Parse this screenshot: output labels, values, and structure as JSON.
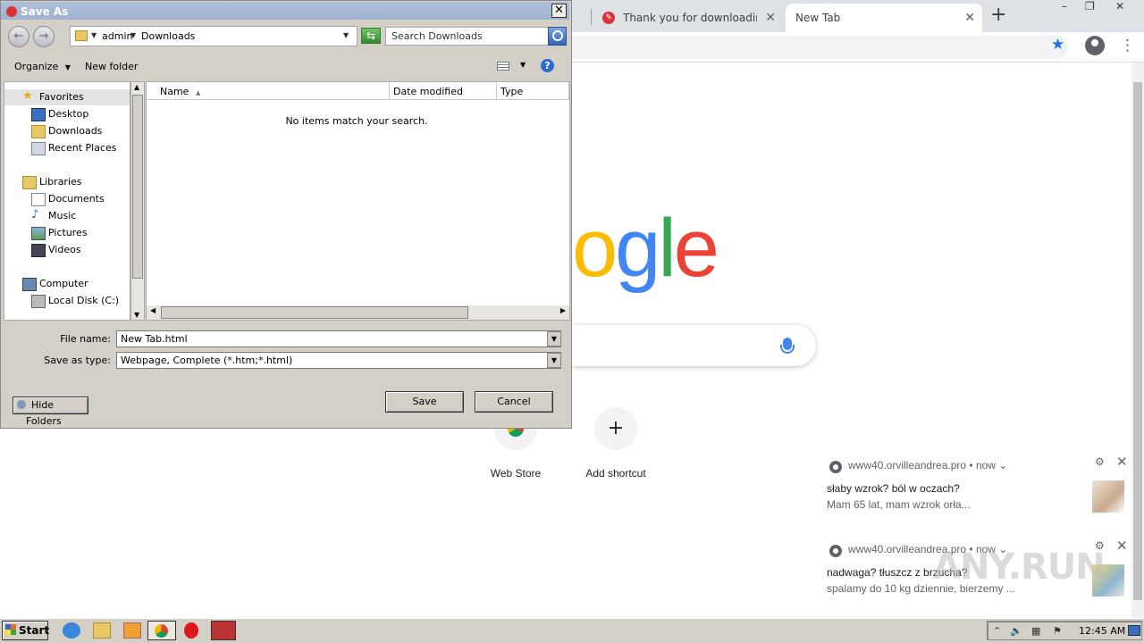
{
  "browser": {
    "tabs": [
      {
        "title": "Thank you for downloading HTT",
        "active": false
      },
      {
        "title": "New Tab",
        "active": true
      }
    ],
    "new_tab_symbol": "+",
    "window_controls": [
      "–",
      "❐",
      "✕"
    ],
    "logo_visible": "ogle",
    "shortcuts": [
      {
        "label": "Web Store"
      },
      {
        "label": "Add shortcut",
        "symbol": "+"
      }
    ],
    "notifications": [
      {
        "source": "www40.orvilleandrea.pro",
        "time": "• now ⌄",
        "title": "słaby wzrok? ból w oczach?",
        "body": "Mam 65 lat, mam wzrok orła..."
      },
      {
        "source": "www40.orvilleandrea.pro",
        "time": "• now ⌄",
        "title": "nadwaga? tłuszcz z brzucha?",
        "body": "spalamy do 10 kg dziennie, bierzemy ..."
      }
    ],
    "watermark": "ANY.RUN"
  },
  "dialog": {
    "title": "Save As",
    "address": {
      "segments": [
        "admin",
        "Downloads"
      ]
    },
    "search_placeholder": "Search Downloads",
    "toolbar": {
      "organize": "Organize",
      "new_folder": "New folder"
    },
    "nav": [
      {
        "label": "Favorites",
        "icon": "star-icon",
        "indent": 0
      },
      {
        "label": "Desktop",
        "icon": "desktop-icon",
        "indent": 1
      },
      {
        "label": "Downloads",
        "icon": "downloads-folder-icon",
        "indent": 1
      },
      {
        "label": "Recent Places",
        "icon": "recent-places-icon",
        "indent": 1
      },
      {
        "label": "Libraries",
        "icon": "libraries-icon",
        "indent": 0
      },
      {
        "label": "Documents",
        "icon": "documents-icon",
        "indent": 1
      },
      {
        "label": "Music",
        "icon": "music-icon",
        "indent": 1
      },
      {
        "label": "Pictures",
        "icon": "pictures-icon",
        "indent": 1
      },
      {
        "label": "Videos",
        "icon": "videos-icon",
        "indent": 1
      },
      {
        "label": "Computer",
        "icon": "computer-icon",
        "indent": 0
      },
      {
        "label": "Local Disk (C:)",
        "icon": "disk-icon",
        "indent": 1
      }
    ],
    "columns": [
      "Name",
      "Date modified",
      "Type"
    ],
    "empty_message": "No items match your search.",
    "file_name_label": "File name:",
    "file_name": "New Tab.html",
    "save_type_label": "Save as type:",
    "save_type": "Webpage, Complete (*.htm;*.html)",
    "save_button": "Save",
    "cancel_button": "Cancel",
    "hide_folders": "Hide Folders"
  },
  "taskbar": {
    "start": "Start",
    "clock": "12:45 AM"
  },
  "colors": {
    "chrome_accent": "#1a73e8",
    "dialog_face": "#d4d0c8",
    "google_blue": "#4285f4",
    "google_green": "#34a853",
    "google_red": "#ea4335",
    "google_yellow": "#fbbc05"
  }
}
